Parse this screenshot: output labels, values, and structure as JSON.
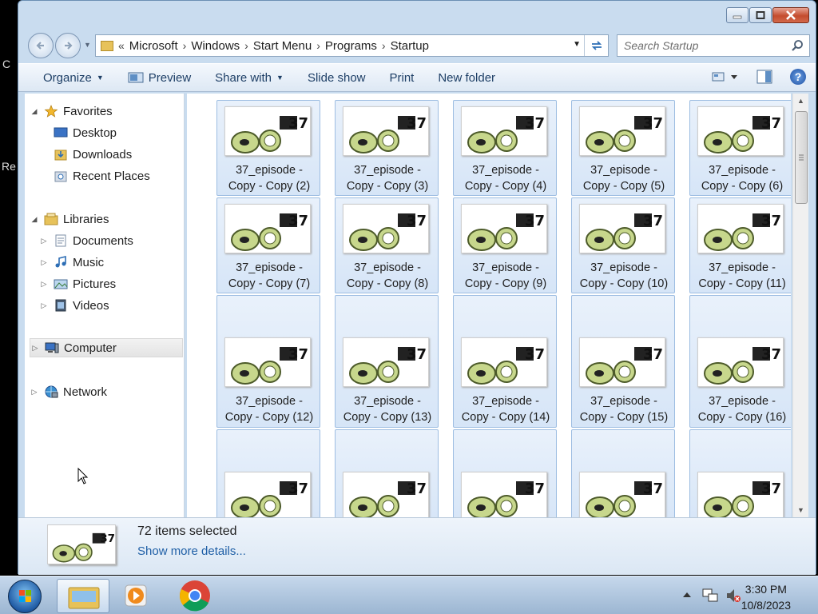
{
  "window": {
    "controls": {
      "minimize": "minimize",
      "maximize": "maximize",
      "close": "close"
    }
  },
  "navigation": {
    "breadcrumb": [
      "Microsoft",
      "Windows",
      "Start Menu",
      "Programs",
      "Startup"
    ],
    "overflow": "«",
    "search_placeholder": "Search Startup"
  },
  "toolbar": {
    "organize": "Organize",
    "preview": "Preview",
    "share_with": "Share with",
    "slide_show": "Slide show",
    "print": "Print",
    "new_folder": "New folder"
  },
  "sidebar": {
    "favorites": {
      "label": "Favorites",
      "items": [
        "Desktop",
        "Downloads",
        "Recent Places"
      ]
    },
    "libraries": {
      "label": "Libraries",
      "items": [
        "Documents",
        "Music",
        "Pictures",
        "Videos"
      ]
    },
    "computer": "Computer",
    "network": "Network"
  },
  "files": [
    {
      "line1": "37_episode -",
      "line2": "Copy - Copy (2)"
    },
    {
      "line1": "37_episode -",
      "line2": "Copy - Copy (3)"
    },
    {
      "line1": "37_episode -",
      "line2": "Copy - Copy (4)"
    },
    {
      "line1": "37_episode -",
      "line2": "Copy - Copy (5)"
    },
    {
      "line1": "37_episode -",
      "line2": "Copy - Copy (6)"
    },
    {
      "line1": "37_episode -",
      "line2": "Copy - Copy (7)"
    },
    {
      "line1": "37_episode -",
      "line2": "Copy - Copy (8)"
    },
    {
      "line1": "37_episode -",
      "line2": "Copy - Copy (9)"
    },
    {
      "line1": "37_episode -",
      "line2": "Copy - Copy (10)"
    },
    {
      "line1": "37_episode -",
      "line2": "Copy - Copy (11)"
    },
    {
      "line1": "37_episode -",
      "line2": "Copy - Copy (12)"
    },
    {
      "line1": "37_episode -",
      "line2": "Copy - Copy (13)"
    },
    {
      "line1": "37_episode -",
      "line2": "Copy - Copy (14)"
    },
    {
      "line1": "37_episode -",
      "line2": "Copy - Copy (15)"
    },
    {
      "line1": "37_episode -",
      "line2": "Copy - Copy (16)"
    },
    {
      "line1": "",
      "line2": ""
    },
    {
      "line1": "",
      "line2": ""
    },
    {
      "line1": "",
      "line2": ""
    },
    {
      "line1": "",
      "line2": ""
    },
    {
      "line1": "",
      "line2": ""
    }
  ],
  "thumbnail_text": "37",
  "details": {
    "count": "72 items selected",
    "more": "Show more details..."
  },
  "taskbar": {
    "time": "3:30 PM",
    "date": "10/8/2023"
  },
  "desktop_fragments": [
    "C",
    "Re"
  ],
  "colors": {
    "selection": "#d6e5f7",
    "selection_border": "#9dbde2",
    "link": "#1f5fa6"
  }
}
